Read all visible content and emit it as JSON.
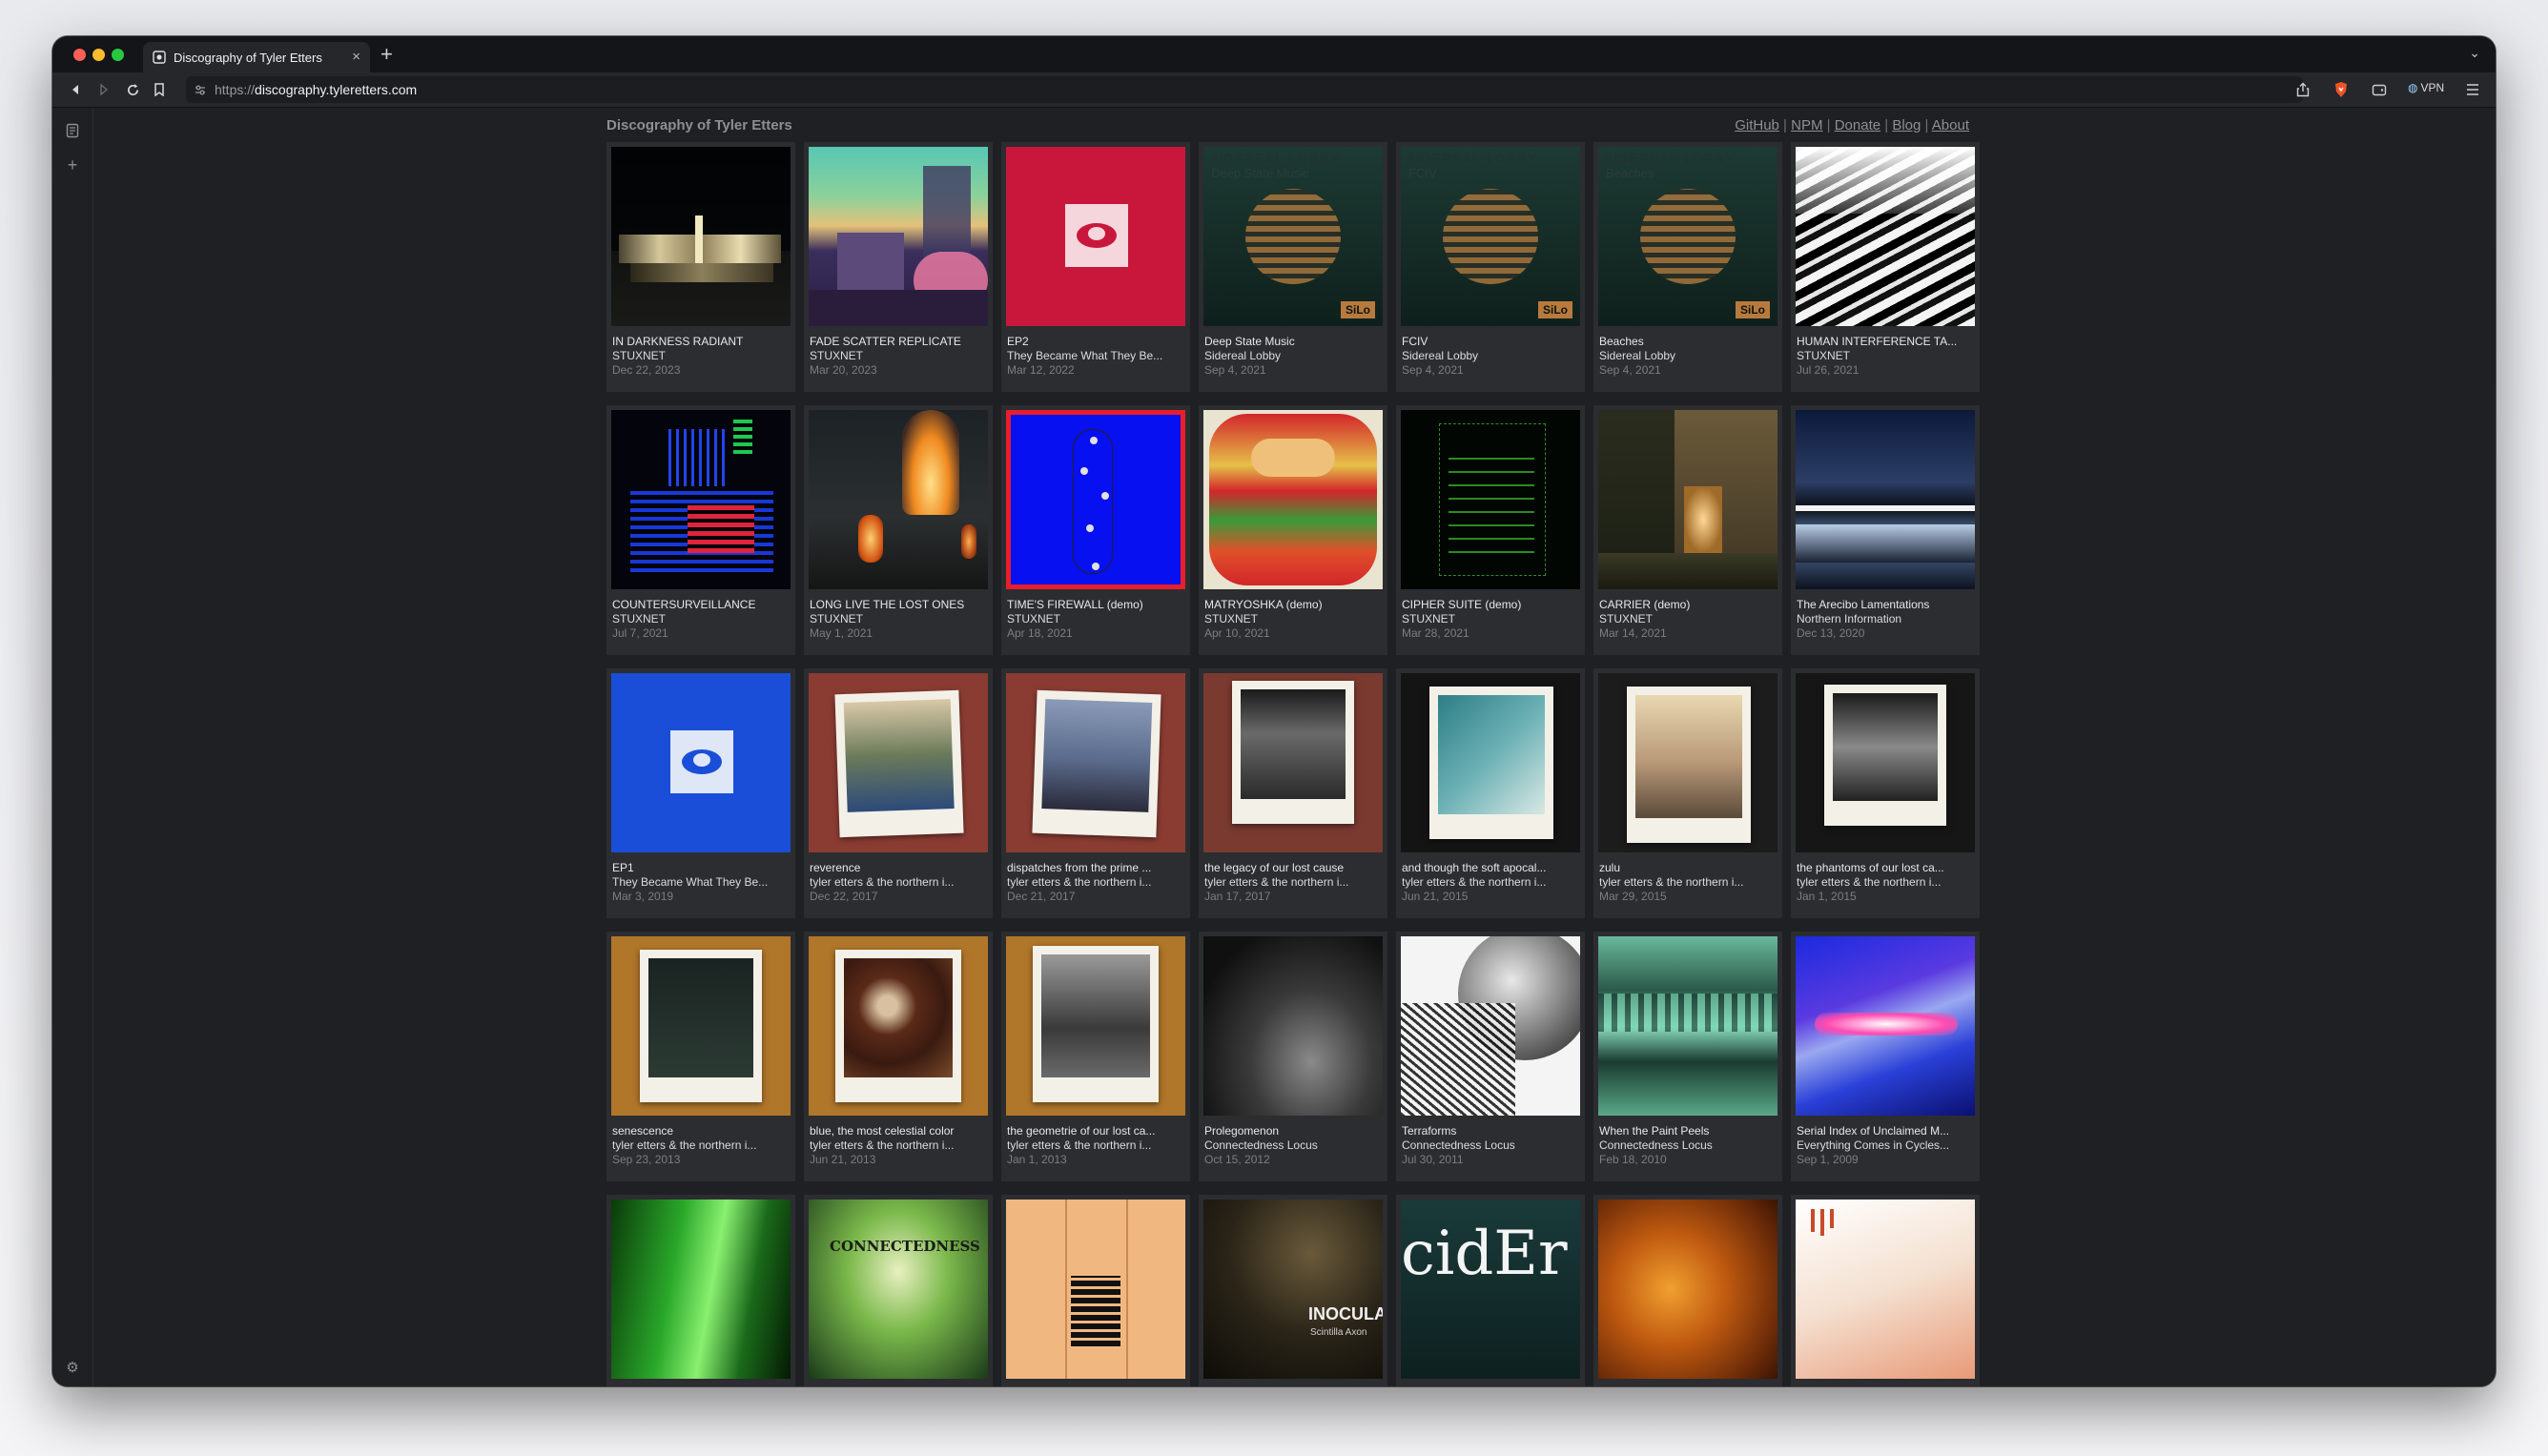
{
  "browser": {
    "tab_title": "Discography of Tyler Etters",
    "url_scheme": "https://",
    "url_host": "discography.tyleretters.com",
    "vpn_label": "VPN"
  },
  "page": {
    "title": "Discography of Tyler Etters",
    "nav": [
      "GitHub",
      "NPM",
      "Donate",
      "Blog",
      "About"
    ],
    "separator": "|"
  },
  "albums": [
    {
      "title": "IN DARKNESS RADIANT",
      "artist": "STUXNET",
      "date": "Dec 22, 2023"
    },
    {
      "title": "FADE SCATTER REPLICATE",
      "artist": "STUXNET",
      "date": "Mar 20, 2023"
    },
    {
      "title": "EP2",
      "artist": "They Became What They Be...",
      "date": "Mar 12, 2022"
    },
    {
      "title": "Deep State Music",
      "artist": "Sidereal Lobby",
      "date": "Sep 4, 2021"
    },
    {
      "title": "FCIV",
      "artist": "Sidereal Lobby",
      "date": "Sep 4, 2021"
    },
    {
      "title": "Beaches",
      "artist": "Sidereal Lobby",
      "date": "Sep 4, 2021"
    },
    {
      "title": "HUMAN INTERFERENCE TA...",
      "artist": "STUXNET",
      "date": "Jul 26, 2021"
    },
    {
      "title": "COUNTERSURVEILLANCE",
      "artist": "STUXNET",
      "date": "Jul 7, 2021"
    },
    {
      "title": "LONG LIVE THE LOST ONES",
      "artist": "STUXNET",
      "date": "May 1, 2021"
    },
    {
      "title": "TIME'S FIREWALL (demo)",
      "artist": "STUXNET",
      "date": "Apr 18, 2021"
    },
    {
      "title": "MATRYOSHKA (demo)",
      "artist": "STUXNET",
      "date": "Apr 10, 2021"
    },
    {
      "title": "CIPHER SUITE (demo)",
      "artist": "STUXNET",
      "date": "Mar 28, 2021"
    },
    {
      "title": "CARRIER (demo)",
      "artist": "STUXNET",
      "date": "Mar 14, 2021"
    },
    {
      "title": "The Arecibo Lamentations",
      "artist": "Northern Information",
      "date": "Dec 13, 2020"
    },
    {
      "title": "EP1",
      "artist": "They Became What They Be...",
      "date": "Mar 3, 2019"
    },
    {
      "title": "reverence",
      "artist": "tyler etters & the northern i...",
      "date": "Dec 22, 2017"
    },
    {
      "title": "dispatches from the prime ...",
      "artist": "tyler etters & the northern i...",
      "date": "Dec 21, 2017"
    },
    {
      "title": "the legacy of our lost cause",
      "artist": "tyler etters & the northern i...",
      "date": "Jan 17, 2017"
    },
    {
      "title": "and though the soft apocal...",
      "artist": "tyler etters & the northern i...",
      "date": "Jun 21, 2015"
    },
    {
      "title": "zulu",
      "artist": "tyler etters & the northern i...",
      "date": "Mar 29, 2015"
    },
    {
      "title": "the phantoms of our lost ca...",
      "artist": "tyler etters & the northern i...",
      "date": "Jan 1, 2015"
    },
    {
      "title": "senescence",
      "artist": "tyler etters & the northern i...",
      "date": "Sep 23, 2013"
    },
    {
      "title": "blue, the most celestial color",
      "artist": "tyler etters & the northern i...",
      "date": "Jun 21, 2013"
    },
    {
      "title": "the geometrie of our lost ca...",
      "artist": "tyler etters & the northern i...",
      "date": "Jan 1, 2013"
    },
    {
      "title": "Prolegomenon",
      "artist": "Connectedness Locus",
      "date": "Oct 15, 2012"
    },
    {
      "title": "Terraforms",
      "artist": "Connectedness Locus",
      "date": "Jul 30, 2011"
    },
    {
      "title": "When the Paint Peels",
      "artist": "Connectedness Locus",
      "date": "Feb 18, 2010"
    },
    {
      "title": "Serial Index of Unclaimed M...",
      "artist": "Everything Comes in Cycles...",
      "date": "Sep 1, 2009"
    },
    {
      "title": "",
      "artist": "",
      "date": ""
    },
    {
      "title": "",
      "artist": "",
      "date": ""
    },
    {
      "title": "",
      "artist": "",
      "date": ""
    },
    {
      "title": "",
      "artist": "",
      "date": ""
    },
    {
      "title": "",
      "artist": "",
      "date": ""
    },
    {
      "title": "",
      "artist": "",
      "date": ""
    },
    {
      "title": "",
      "artist": "",
      "date": ""
    }
  ],
  "cover_text": {
    "sidereal_lobby": "SIDEREAL LOBBY",
    "sidereal_subs": [
      "Deep State Music",
      "FCIV",
      "Beaches"
    ],
    "silo": "SiLo",
    "connectedness": "CONNECTEDNESS",
    "inocula": "INOCULA",
    "inocula_sub": "Scintilla Axon",
    "cider": "cidEr"
  }
}
